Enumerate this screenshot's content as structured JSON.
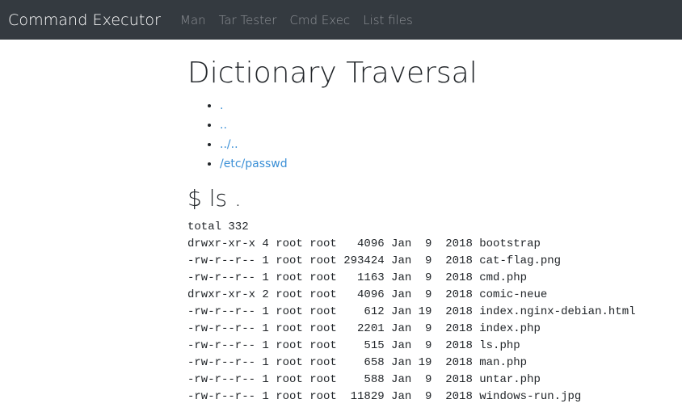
{
  "navbar": {
    "brand": "Command Executor",
    "links": [
      "Man",
      "Tar Tester",
      "Cmd Exec",
      "List files"
    ]
  },
  "main": {
    "title": "Dictionary Traversal",
    "dir_links": [
      ".",
      "..",
      "../..",
      "/etc/passwd"
    ],
    "command_heading": "$ ls .",
    "output_lines": [
      "total 332",
      "drwxr-xr-x 4 root root   4096 Jan  9  2018 bootstrap",
      "-rw-r--r-- 1 root root 293424 Jan  9  2018 cat-flag.png",
      "-rw-r--r-- 1 root root   1163 Jan  9  2018 cmd.php",
      "drwxr-xr-x 2 root root   4096 Jan  9  2018 comic-neue",
      "-rw-r--r-- 1 root root    612 Jan 19  2018 index.nginx-debian.html",
      "-rw-r--r-- 1 root root   2201 Jan  9  2018 index.php",
      "-rw-r--r-- 1 root root    515 Jan  9  2018 ls.php",
      "-rw-r--r-- 1 root root    658 Jan 19  2018 man.php",
      "-rw-r--r-- 1 root root    588 Jan  9  2018 untar.php",
      "-rw-r--r-- 1 root root  11829 Jan  9  2018 windows-run.jpg"
    ]
  }
}
